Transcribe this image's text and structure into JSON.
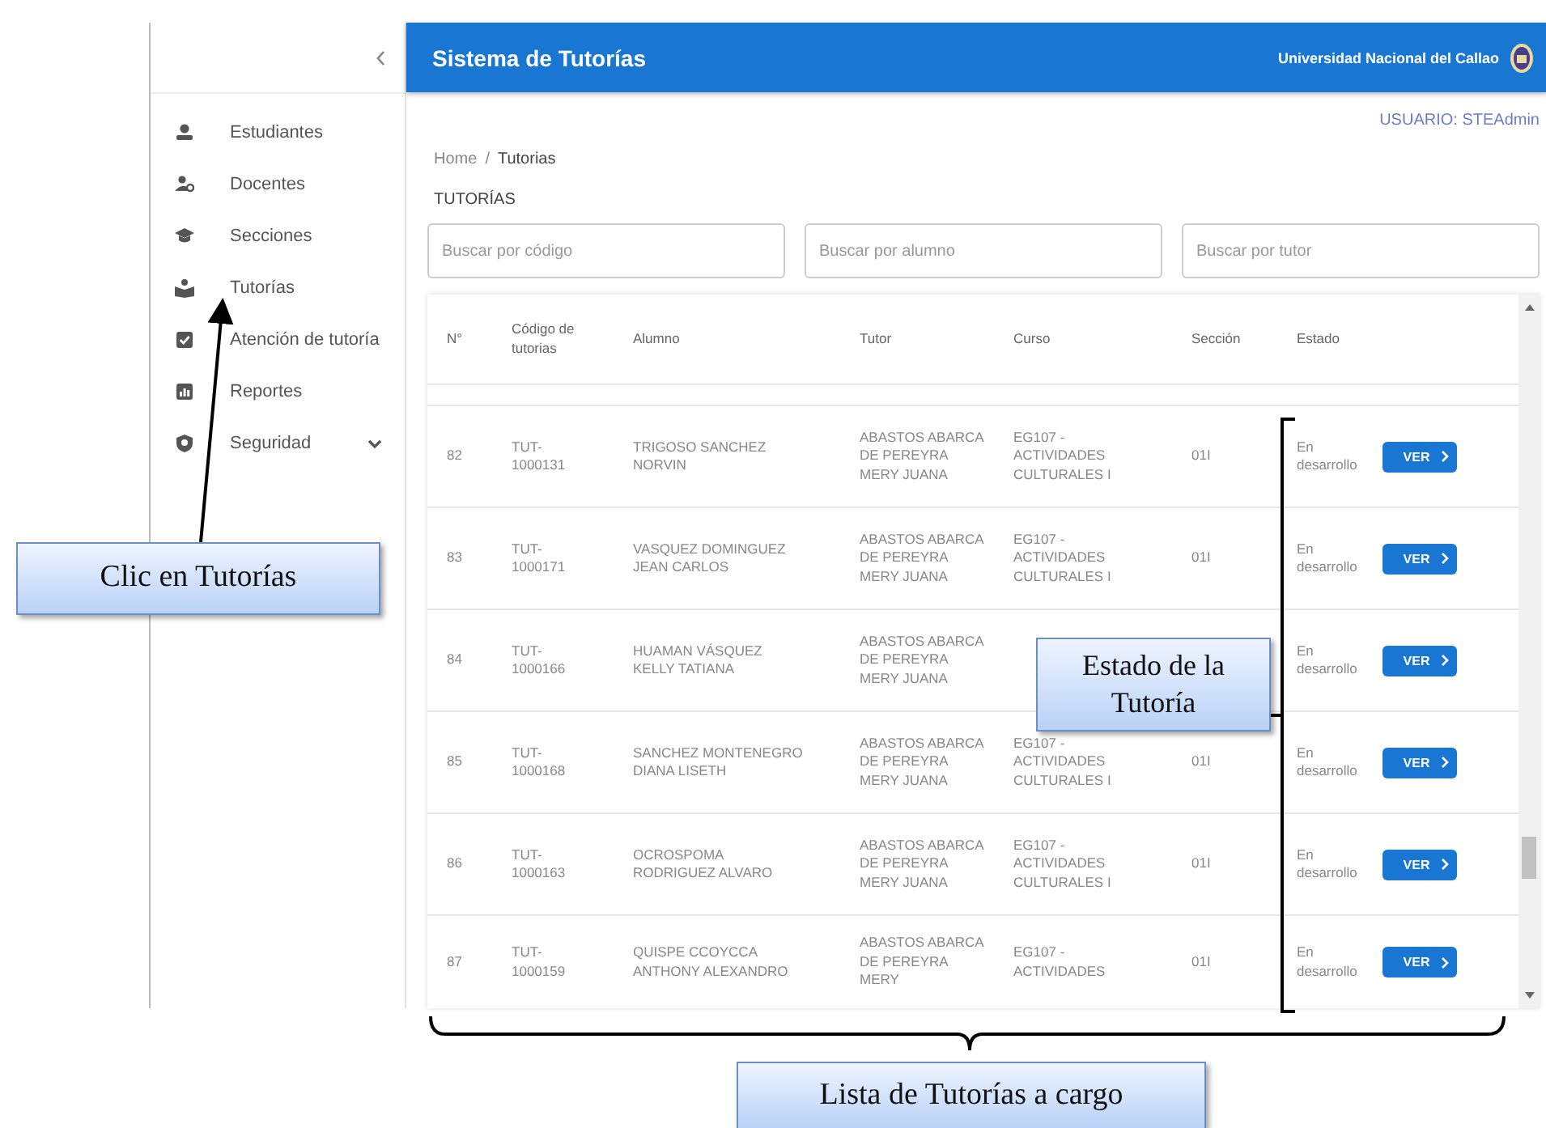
{
  "sidebar": {
    "items": [
      {
        "label": "Estudiantes",
        "kind": "link"
      },
      {
        "label": "Docentes",
        "kind": "link"
      },
      {
        "label": "Secciones",
        "kind": "link"
      },
      {
        "label": "Tutorías",
        "kind": "link"
      },
      {
        "label": "Atención de tutoría",
        "kind": "link"
      },
      {
        "label": "Reportes",
        "kind": "link"
      },
      {
        "label": "Seguridad",
        "kind": "group"
      }
    ]
  },
  "header": {
    "title": "Sistema de Tutorías",
    "university": "Universidad Nacional del Callao"
  },
  "user": "USUARIO: STEAdmin",
  "breadcrumb": {
    "items": [
      "Home",
      "Tutorias"
    ],
    "separator": "/"
  },
  "page_title": "TUTORÍAS",
  "filters": [
    {
      "placeholder": "Buscar por código"
    },
    {
      "placeholder": "Buscar por alumno"
    },
    {
      "placeholder": "Buscar por tutor"
    }
  ],
  "table": {
    "columns": [
      "N°",
      "Código de tutorias",
      "Alumno",
      "Tutor",
      "Curso",
      "Sección",
      "Estado"
    ],
    "rows": [
      {
        "n": "82",
        "codigo": "TUT-1000131",
        "alumno": "TRIGOSO SANCHEZ NORVIN",
        "tutor": "ABASTOS ABARCA DE PEREYRA MERY JUANA",
        "curso": "EG107 - ACTIVIDADES CULTURALES I",
        "seccion": "01I",
        "estado": "En desarrollo",
        "action": "VER"
      },
      {
        "n": "83",
        "codigo": "TUT-1000171",
        "alumno": "VASQUEZ DOMINGUEZ JEAN CARLOS",
        "tutor": "ABASTOS ABARCA DE PEREYRA MERY JUANA",
        "curso": "EG107 - ACTIVIDADES CULTURALES I",
        "seccion": "01I",
        "estado": "En desarrollo",
        "action": "VER"
      },
      {
        "n": "84",
        "codigo": "TUT-1000166",
        "alumno": "HUAMAN VÁSQUEZ KELLY TATIANA",
        "tutor": "ABASTOS ABARCA DE PEREYRA MERY JUANA",
        "estado": "En desarrollo",
        "action": "VER"
      },
      {
        "n": "85",
        "codigo": "TUT-1000168",
        "alumno": "SANCHEZ MONTENEGRO DIANA LISETH",
        "tutor": "ABASTOS ABARCA DE PEREYRA MERY JUANA",
        "curso": "EG107 - ACTIVIDADES CULTURALES I",
        "seccion": "01I",
        "estado": "En desarrollo",
        "action": "VER"
      },
      {
        "n": "86",
        "codigo": "TUT-1000163",
        "alumno": "OCROSPOMA RODRIGUEZ ALVARO",
        "tutor": "ABASTOS ABARCA DE PEREYRA MERY JUANA",
        "curso": "EG107 - ACTIVIDADES CULTURALES I",
        "seccion": "01I",
        "estado": "En desarrollo",
        "action": "VER"
      },
      {
        "n": "87",
        "codigo": "TUT-1000159",
        "alumno": "QUISPE CCOYCCA ANTHONY ALEXANDRO",
        "tutor": "ABASTOS ABARCA DE PEREYRA MERY",
        "curso": "EG107 - ACTIVIDADES",
        "seccion": "01I",
        "estado": "En desarrollo",
        "action": "VER"
      }
    ]
  },
  "annotations": [
    {
      "kind": "arrow",
      "text": "Clic en Tutorías"
    },
    {
      "kind": "bracket",
      "text": "Estado de la Tutoría"
    },
    {
      "kind": "brace",
      "text": "Lista de Tutorías a cargo"
    }
  ]
}
